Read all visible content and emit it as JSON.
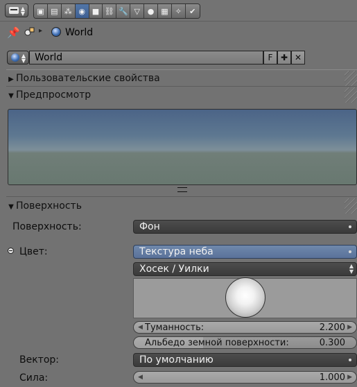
{
  "header": {
    "editor_type_icon": "properties-editor-icon",
    "tabs": [
      {
        "name": "render-tab",
        "icon": "camera-icon",
        "glyph": "▣"
      },
      {
        "name": "render-layers-tab",
        "icon": "render-layers-icon",
        "glyph": "▤"
      },
      {
        "name": "scene-tab",
        "icon": "scene-icon",
        "glyph": "⁂"
      },
      {
        "name": "world-tab",
        "icon": "world-icon",
        "glyph": "◉"
      },
      {
        "name": "object-tab",
        "icon": "object-cube-icon",
        "glyph": "■"
      },
      {
        "name": "constraints-tab",
        "icon": "constraint-link-icon",
        "glyph": "⛓"
      },
      {
        "name": "modifiers-tab",
        "icon": "wrench-icon",
        "glyph": "🔧"
      },
      {
        "name": "data-tab",
        "icon": "mesh-data-icon",
        "glyph": "▽"
      },
      {
        "name": "material-tab",
        "icon": "material-sphere-icon",
        "glyph": "●"
      },
      {
        "name": "texture-tab",
        "icon": "texture-checker-icon",
        "glyph": "▦"
      },
      {
        "name": "particles-tab",
        "icon": "particles-icon",
        "glyph": "✧"
      },
      {
        "name": "physics-tab",
        "icon": "physics-icon",
        "glyph": "✔"
      }
    ],
    "active_tab_index": 3
  },
  "breadcrumb": {
    "world": "World"
  },
  "datablock": {
    "name": "World",
    "fake_user": "F",
    "add": "✚",
    "remove": "✕"
  },
  "panels": {
    "custom_props": "Пользовательские свойства",
    "preview": "Предпросмотр",
    "surface": "Поверхность"
  },
  "surface": {
    "surface_label": "Поверхность:",
    "surface_value": "Фон",
    "color_label": "Цвет:",
    "color_value": "Текстура неба",
    "sky_model": "Хосек / Уилки",
    "turbidity_label": "Туманность:",
    "turbidity_value": "2.200",
    "albedo_label": "Альбедо земной поверхности:",
    "albedo_value": "0.300",
    "vector_label": "Вектор:",
    "vector_value": "По умолчанию",
    "strength_label": "Сила:",
    "strength_value": "1.000"
  },
  "colors": {
    "background": "#727272",
    "active_tab": "#4a6c9f",
    "selected_menu": "#6480a6"
  }
}
